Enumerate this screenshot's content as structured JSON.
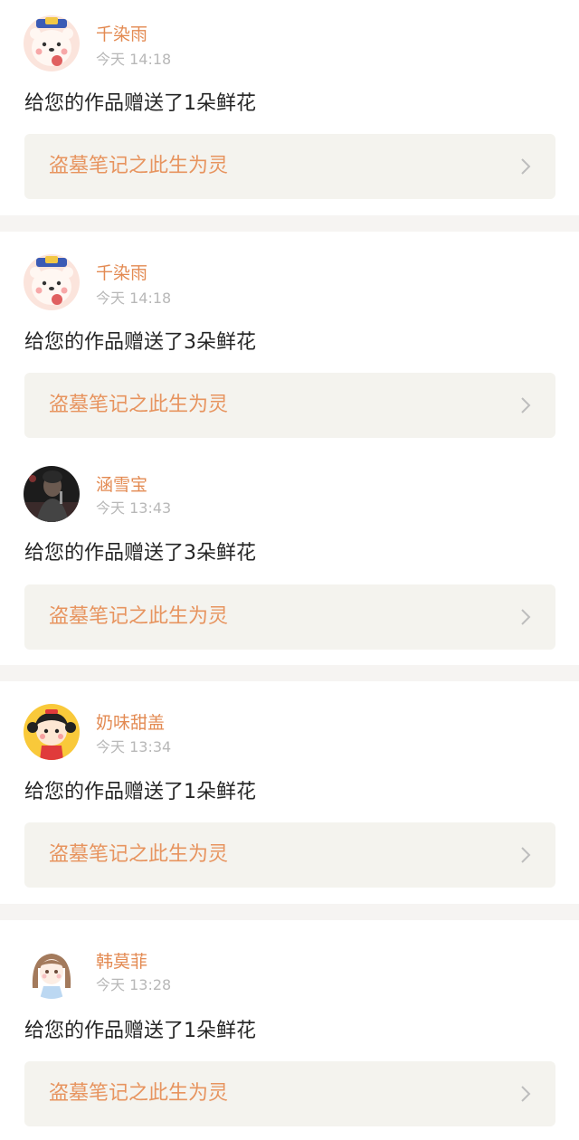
{
  "notifications": [
    {
      "avatar": "bear-avatar-icon",
      "user": "千染雨",
      "time": "今天 14:18",
      "message": "给您的作品赠送了1朵鲜花",
      "work_title": "盗墓笔记之此生为灵"
    },
    {
      "avatar": "bear-avatar-icon",
      "user": "千染雨",
      "time": "今天 14:18",
      "message": "给您的作品赠送了3朵鲜花",
      "work_title": "盗墓笔记之此生为灵"
    },
    {
      "avatar": "singer-photo-avatar",
      "user": "涵雪宝",
      "time": "今天 13:43",
      "message": "给您的作品赠送了3朵鲜花",
      "work_title": "盗墓笔记之此生为灵"
    },
    {
      "avatar": "cartoon-girl-avatar",
      "user": "奶味甜盖",
      "time": "今天 13:34",
      "message": "给您的作品赠送了1朵鲜花",
      "work_title": "盗墓笔记之此生为灵"
    },
    {
      "avatar": "anime-girl-avatar",
      "user": "韩莫菲",
      "time": "今天 13:28",
      "message": "给您的作品赠送了1朵鲜花",
      "work_title": "盗墓笔记之此生为灵"
    }
  ],
  "colors": {
    "username": "#e38a52",
    "time": "#b8b8b8",
    "message": "#262626",
    "card_bg": "#f4f3ee",
    "card_title": "#e7945f",
    "divider": "#f6f4f2"
  }
}
